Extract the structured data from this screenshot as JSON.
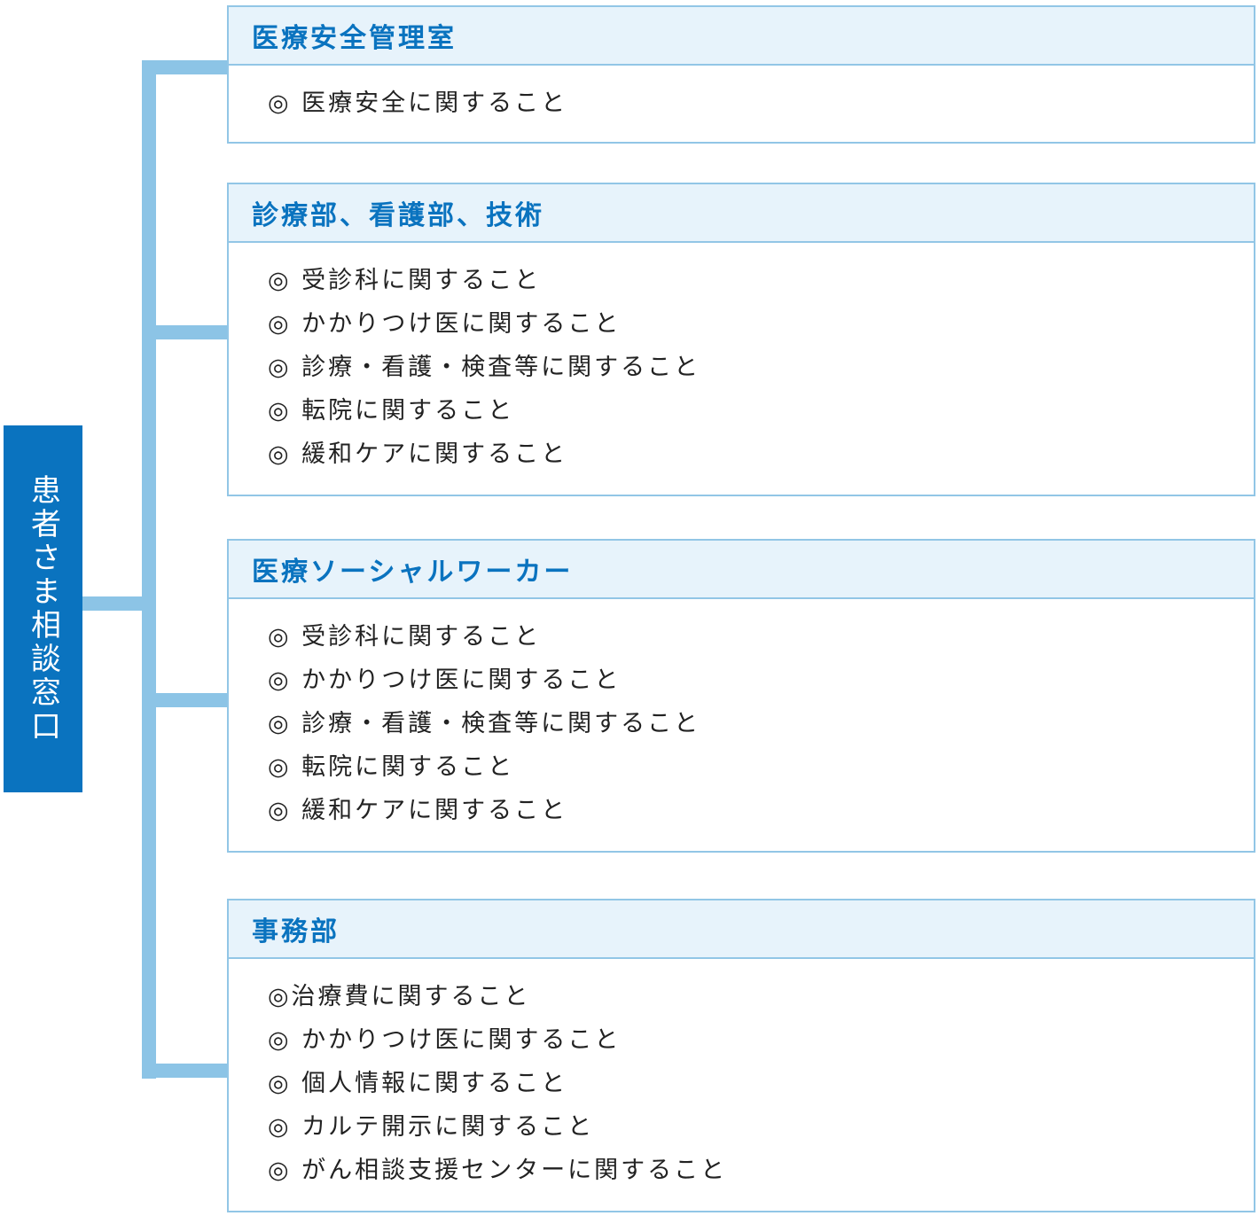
{
  "root": {
    "label": "患者さま相談窓口"
  },
  "departments": [
    {
      "title": "医療安全管理室",
      "items": [
        "◎ 医療安全に関すること"
      ]
    },
    {
      "title": "診療部、看護部、技術",
      "items": [
        "◎ 受診科に関すること",
        "◎ かかりつけ医に関すること",
        "◎ 診療・看護・検査等に関すること",
        "◎ 転院に関すること",
        "◎ 緩和ケアに関すること"
      ]
    },
    {
      "title": "医療ソーシャルワーカー",
      "items": [
        "◎ 受診科に関すること",
        "◎ かかりつけ医に関すること",
        "◎ 診療・看護・検査等に関すること",
        "◎ 転院に関すること",
        "◎ 緩和ケアに関すること"
      ]
    },
    {
      "title": "事務部",
      "items": [
        "◎治療費に関すること",
        "◎ かかりつけ医に関すること",
        "◎ 個人情報に関すること",
        "◎ カルテ開示に関すること",
        "◎ がん相談支援センターに関すること"
      ]
    }
  ],
  "colors": {
    "root_fill": "#0a73bf",
    "connector": "#8cc4e6",
    "box_border": "#92c6e6",
    "header_fill": "#e7f3fb",
    "title_text": "#0a73bf"
  }
}
